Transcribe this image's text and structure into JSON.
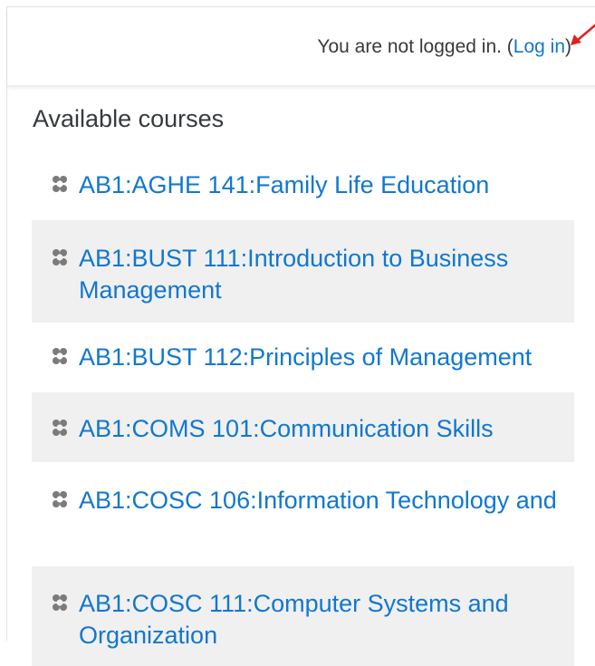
{
  "login": {
    "prefix": "You are not logged in. (",
    "link_label": "Log in",
    "suffix": ")"
  },
  "section_title": "Available courses",
  "courses": [
    {
      "label": "AB1:AGHE 141:Family Life Education"
    },
    {
      "label": "AB1:BUST 111:Introduction to Business Management"
    },
    {
      "label": "AB1:BUST 112:Principles of Management"
    },
    {
      "label": "AB1:COMS 101:Communication Skills"
    },
    {
      "label": "AB1:COSC 106:Information Technology and"
    },
    {
      "label": "AB1:COSC 111:Computer Systems and Organization"
    }
  ],
  "colors": {
    "link": "#1177d1",
    "text": "#373a3c",
    "stripe": "#f0f0f0",
    "annotation_arrow": "#e02020"
  },
  "icons": {
    "course": "course-icon",
    "annotation": "red-arrow-icon"
  }
}
